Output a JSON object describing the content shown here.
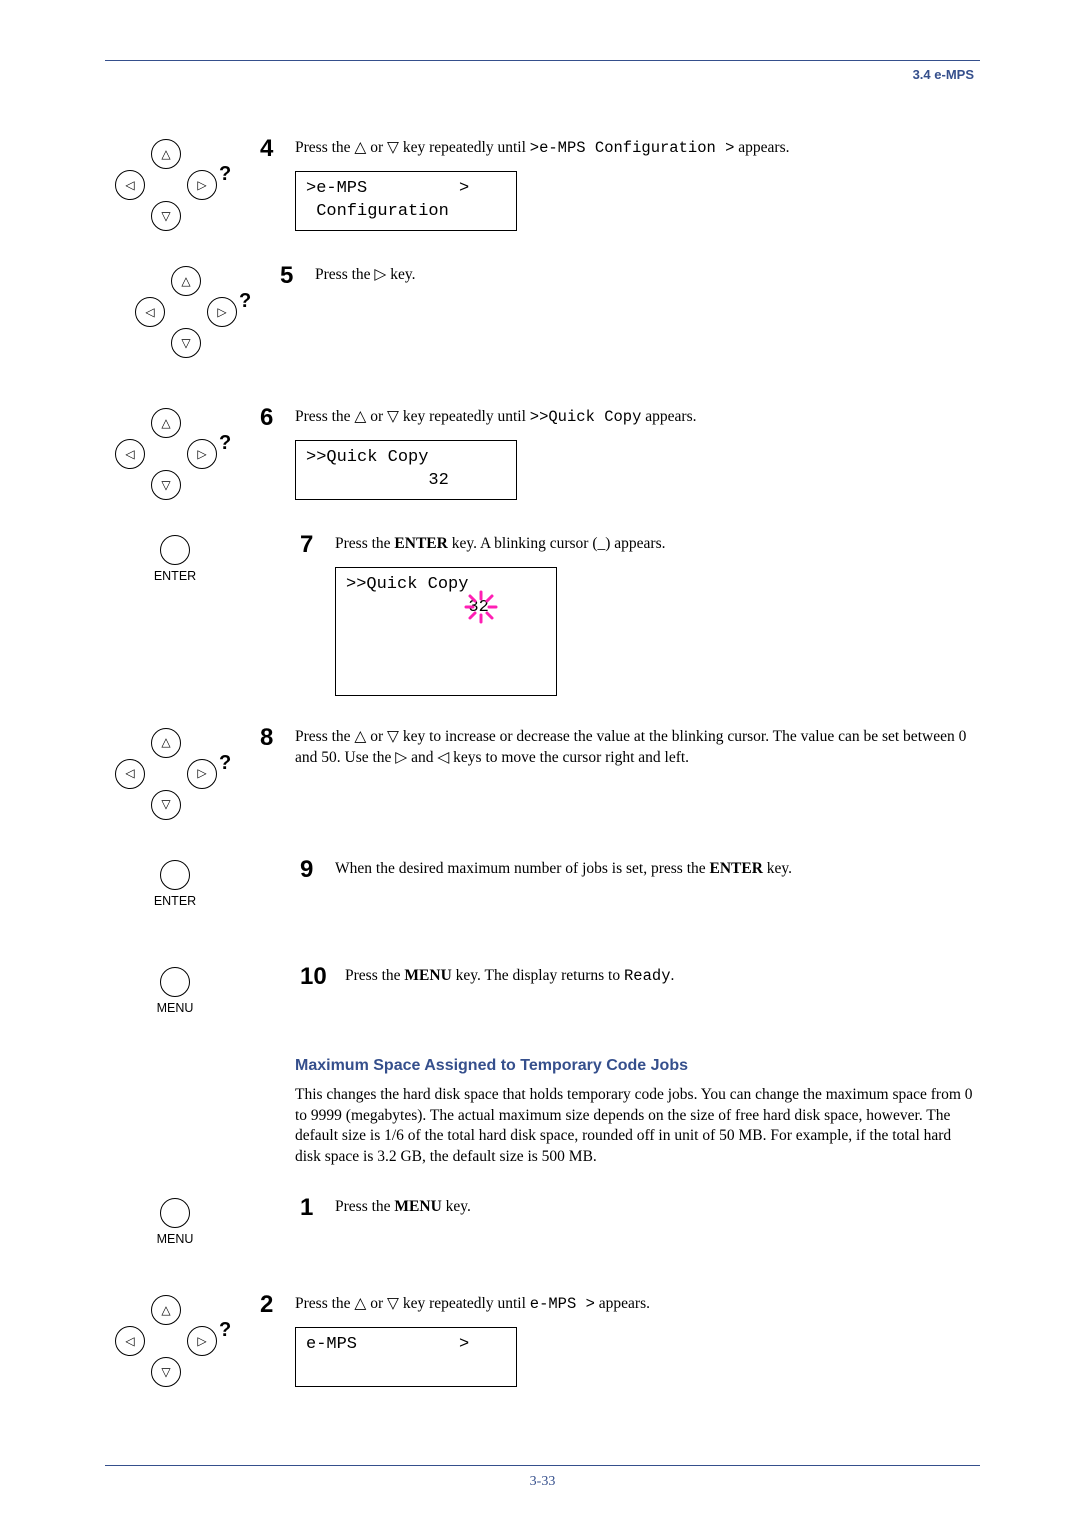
{
  "header": {
    "section": "3.4 e-MPS"
  },
  "steps_a": [
    {
      "n": "4",
      "text_pre": "Press the ",
      "text_post": " key repeatedly until ",
      "code": ">e-MPS Configuration >",
      "tail": " appears.",
      "lcd_line1": ">e-MPS         >",
      "lcd_line2": " Configuration"
    },
    {
      "n": "5",
      "text_pre": "Press the ",
      "text_post": " key.",
      "code": "",
      "tail": ""
    },
    {
      "n": "6",
      "text_pre": "Press the ",
      "text_post": " key repeatedly until ",
      "code": ">>Quick Copy",
      "tail": " appears.",
      "lcd_line1": ">>Quick Copy",
      "lcd_line2": "            32"
    },
    {
      "n": "7",
      "text_pre": "Press the ",
      "bold1": "ENTER",
      "text_mid": " key. A blinking cursor (_) appears.",
      "lcd_line1": ">>Quick Copy",
      "lcd_line2": "            32"
    },
    {
      "n": "8",
      "text": "Press the △ or ▽ key to increase or decrease the value at the blinking cursor. The value can be set between 0 and 50. Use the ▷ and ◁ keys to move the cursor right and left."
    },
    {
      "n": "9",
      "text_pre": "When the desired maximum number of jobs is set, press the ",
      "bold1": "ENTER",
      "text_post": " key."
    },
    {
      "n": "10",
      "text_pre": "Press the ",
      "bold1": "MENU",
      "text_mid": " key. The display returns to ",
      "code": "Ready",
      "tail": "."
    }
  ],
  "section": {
    "title": "Maximum Space Assigned to Temporary Code Jobs",
    "body": "This changes the hard disk space that holds temporary code jobs. You can change the maximum space from 0 to 9999 (megabytes). The actual maximum size depends on the size of free hard disk space, however. The default size is 1/6 of the total hard disk space, rounded off in unit of 50 MB. For example, if the total hard disk space is 3.2 GB, the default size is 500 MB."
  },
  "steps_b": [
    {
      "n": "1",
      "text_pre": "Press the ",
      "bold1": "MENU",
      "text_post": " key."
    },
    {
      "n": "2",
      "text_pre": "Press the ",
      "text_post": " key repeatedly until ",
      "code": "e-MPS >",
      "tail": " appears.",
      "lcd_line1": "e-MPS          >",
      "lcd_line2": " "
    }
  ],
  "footer": {
    "page": "3-33"
  },
  "glyphs": {
    "up": "△",
    "down": "▽",
    "left": "◁",
    "right": "▷"
  },
  "keys": {
    "enter": "ENTER",
    "menu": "MENU"
  }
}
